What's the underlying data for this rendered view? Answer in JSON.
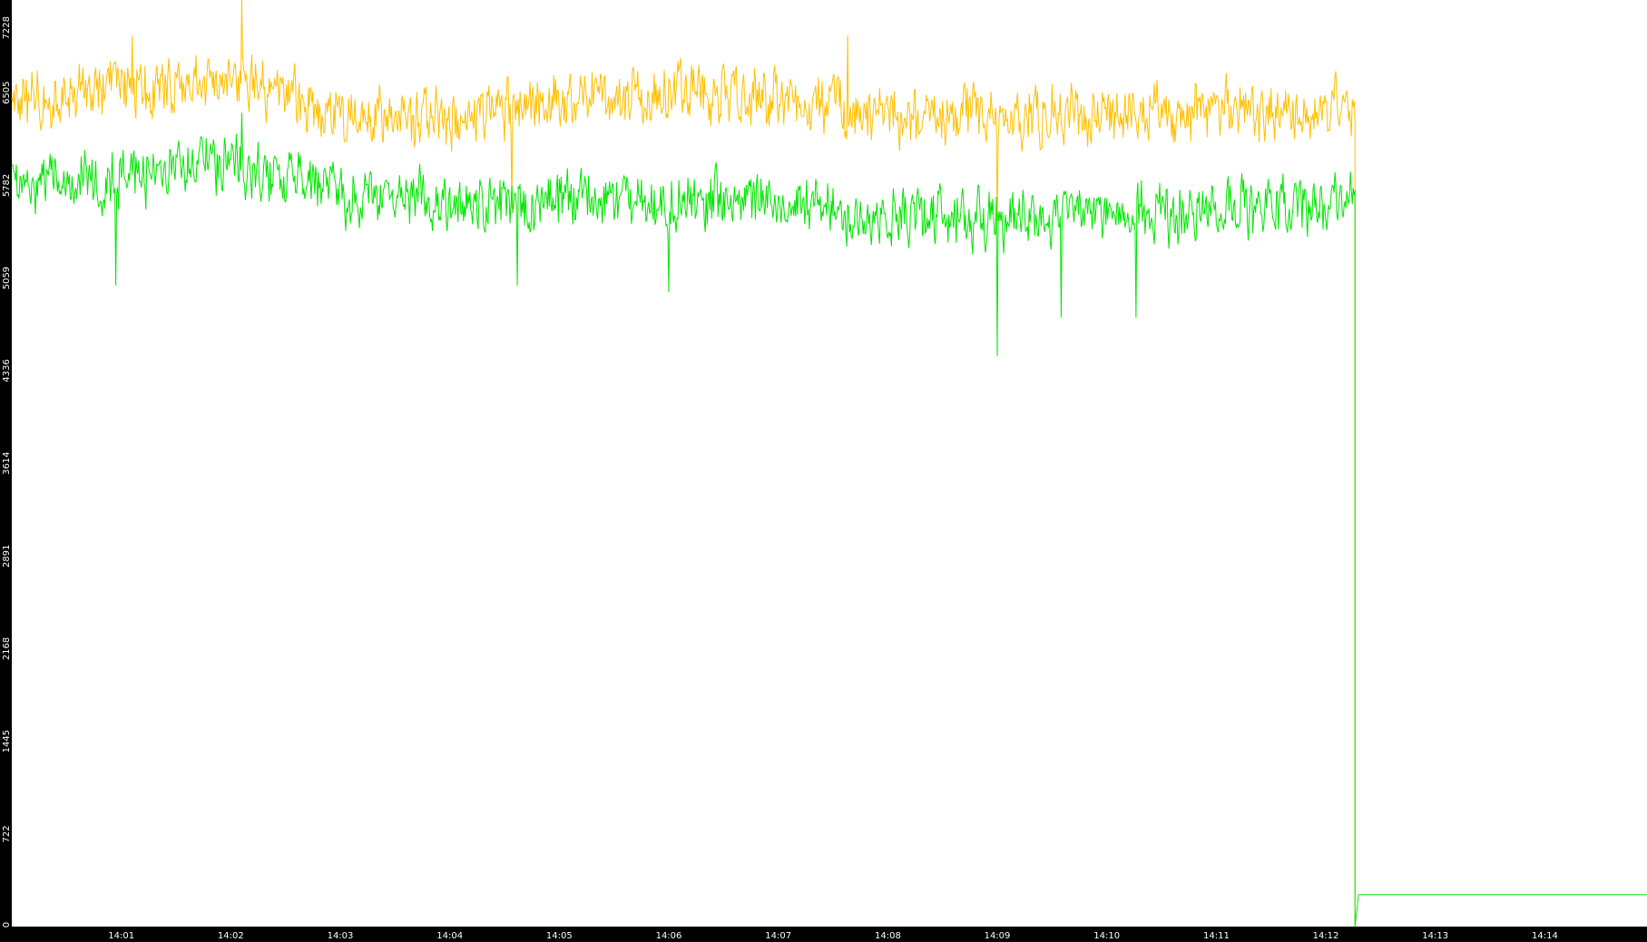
{
  "chart_data": {
    "type": "line",
    "title": "",
    "xlabel": "",
    "ylabel": "",
    "xlim": [
      "14:00:00",
      "14:14:56"
    ],
    "ylim": [
      0,
      7228
    ],
    "x_ticks": [
      "14:01",
      "14:02",
      "14:03",
      "14:04",
      "14:05",
      "14:06",
      "14:07",
      "14:08",
      "14:09",
      "14:10",
      "14:11",
      "14:12",
      "14:13",
      "14:14"
    ],
    "y_ticks": [
      "0",
      "722",
      "1445",
      "2168",
      "2891",
      "3614",
      "4336",
      "5059",
      "5782",
      "6505",
      "7228"
    ],
    "grid": false,
    "legend": "none",
    "background": "#ffffff",
    "axis_background": "#000000",
    "axis_text_color": "#ffffff",
    "sample_interval_seconds": 0.5,
    "series": [
      {
        "color": "#ffc000",
        "mean_by_minute": [
          {
            "t": "14:00:00",
            "v": 6400
          },
          {
            "t": "14:01:00",
            "v": 6550
          },
          {
            "t": "14:02:00",
            "v": 6600
          },
          {
            "t": "14:03:00",
            "v": 6350
          },
          {
            "t": "14:04:00",
            "v": 6300
          },
          {
            "t": "14:05:00",
            "v": 6450
          },
          {
            "t": "14:06:00",
            "v": 6500
          },
          {
            "t": "14:07:00",
            "v": 6450
          },
          {
            "t": "14:08:00",
            "v": 6300
          },
          {
            "t": "14:09:00",
            "v": 6350
          },
          {
            "t": "14:10:00",
            "v": 6350
          },
          {
            "t": "14:11:00",
            "v": 6350
          },
          {
            "t": "14:12:00",
            "v": 6350
          },
          {
            "t": "14:12:16",
            "v": 6400
          }
        ],
        "spikes": [
          {
            "t": "14:02:06",
            "v": 7228
          },
          {
            "t": "14:01:06",
            "v": 6950
          },
          {
            "t": "14:07:38",
            "v": 6950
          },
          {
            "t": "14:04:34",
            "v": 5600
          },
          {
            "t": "14:09:00",
            "v": 5500
          }
        ],
        "drop": {
          "t": "14:12:16",
          "to": 0
        }
      },
      {
        "color": "#00e600",
        "mean_by_minute": [
          {
            "t": "14:00:00",
            "v": 5800
          },
          {
            "t": "14:01:00",
            "v": 5850
          },
          {
            "t": "14:02:00",
            "v": 5950
          },
          {
            "t": "14:03:00",
            "v": 5700
          },
          {
            "t": "14:04:00",
            "v": 5650
          },
          {
            "t": "14:05:00",
            "v": 5650
          },
          {
            "t": "14:06:00",
            "v": 5650
          },
          {
            "t": "14:07:00",
            "v": 5650
          },
          {
            "t": "14:08:00",
            "v": 5550
          },
          {
            "t": "14:09:00",
            "v": 5500
          },
          {
            "t": "14:10:00",
            "v": 5550
          },
          {
            "t": "14:11:00",
            "v": 5600
          },
          {
            "t": "14:12:00",
            "v": 5600
          },
          {
            "t": "14:12:16",
            "v": 5750
          }
        ],
        "spikes": [
          {
            "t": "14:09:00",
            "v": 4450
          },
          {
            "t": "14:09:35",
            "v": 4750
          },
          {
            "t": "14:10:16",
            "v": 4750
          },
          {
            "t": "14:00:57",
            "v": 5000
          },
          {
            "t": "14:04:37",
            "v": 5000
          },
          {
            "t": "14:06:00",
            "v": 4950
          },
          {
            "t": "14:02:06",
            "v": 6350
          }
        ],
        "drop": {
          "t": "14:12:16",
          "to": 0,
          "via": [
            3300,
            2950
          ]
        },
        "after_drop": [
          {
            "t": "14:12:18",
            "v": 250
          },
          {
            "t": "14:14:56",
            "v": 250
          }
        ]
      }
    ]
  }
}
